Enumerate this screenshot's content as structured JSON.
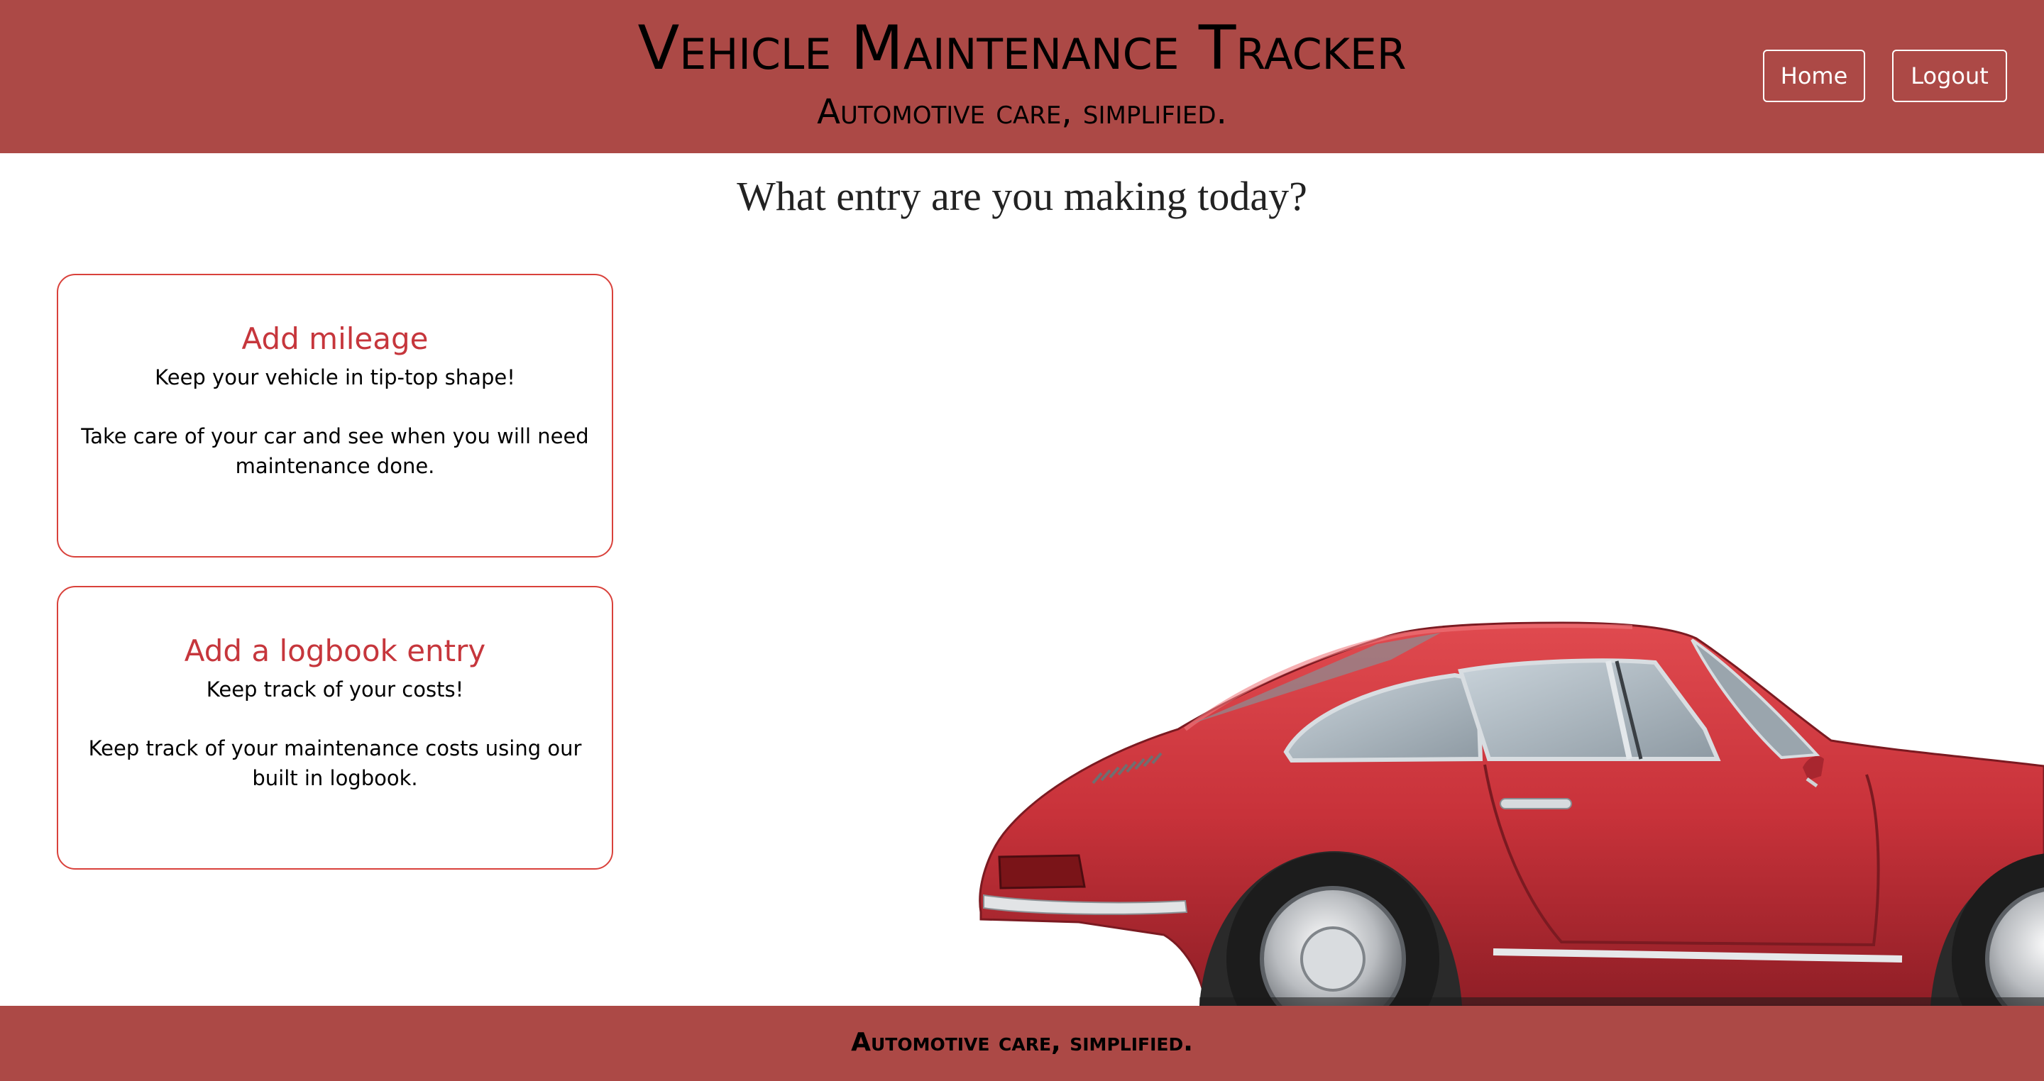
{
  "header": {
    "title": "Vehicle Maintenance Tracker",
    "tagline": "Automotive care, simplified.",
    "nav": {
      "home_label": "Home",
      "logout_label": "Logout"
    }
  },
  "main": {
    "prompt": "What entry are you making today?",
    "cards": [
      {
        "title": "Add mileage",
        "subtitle": "Keep your vehicle in tip-top shape!",
        "text": "Take care of your car and see when you will need maintenance done."
      },
      {
        "title": "Add a logbook entry",
        "subtitle": "Keep track of your costs!",
        "text": "Keep track of your maintenance costs using our built in logbook."
      }
    ]
  },
  "footer": {
    "text": "Automotive care, simplified."
  },
  "colors": {
    "brand_bar": "#ac4946",
    "card_border": "#d9413b",
    "card_title": "#c6363c",
    "car_body": "#c8323a"
  },
  "icons": {
    "hero_image": "red-classic-car-image"
  }
}
